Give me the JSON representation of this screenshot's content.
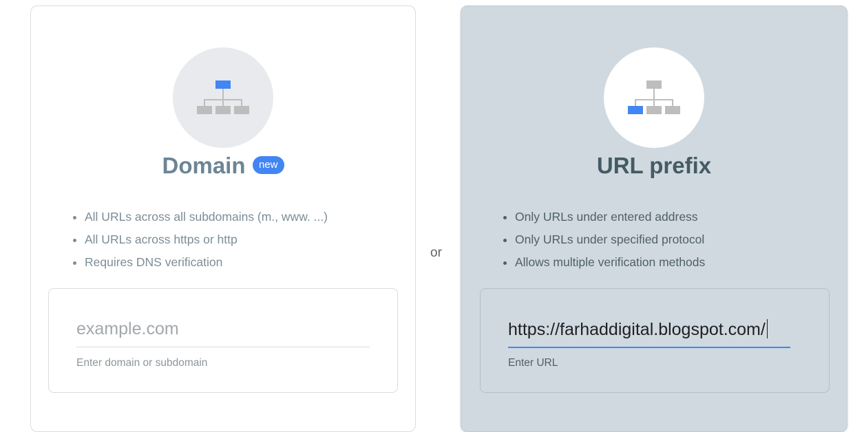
{
  "divider_text": "or",
  "domain_card": {
    "title": "Domain",
    "badge": "new",
    "bullets": [
      "All URLs across all subdomains (m., www. ...)",
      "All URLs across https or http",
      "Requires DNS verification"
    ],
    "input": {
      "value": "",
      "placeholder": "example.com",
      "helper": "Enter domain or subdomain"
    },
    "icon": "sitemap-icon"
  },
  "url_card": {
    "title": "URL prefix",
    "bullets": [
      "Only URLs under entered address",
      "Only URLs under specified protocol",
      "Allows multiple verification methods"
    ],
    "input": {
      "value": "https://farhaddigital.blogspot.com/",
      "helper": "Enter URL"
    },
    "icon": "sitemap-icon",
    "selected": true
  },
  "colors": {
    "accent": "#4285f4",
    "selected_card_bg": "#d0d9df",
    "icon_gray": "#bdbdbd"
  }
}
